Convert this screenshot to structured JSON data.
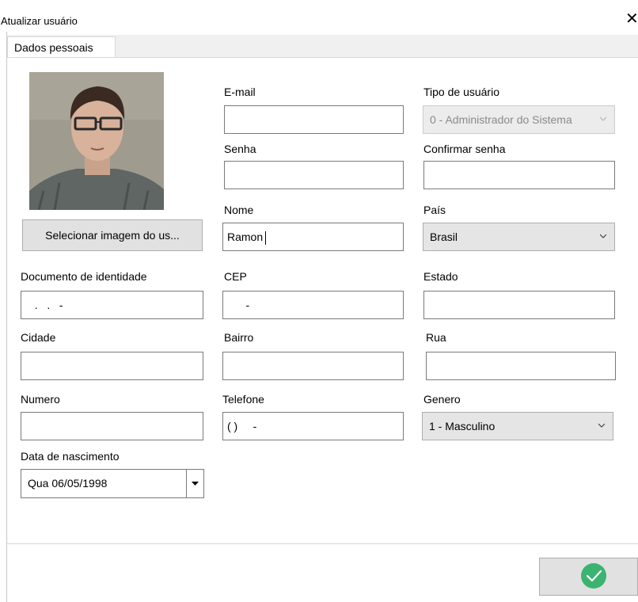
{
  "window": {
    "title": "Atualizar usuário",
    "close_glyph": "✕"
  },
  "tabs": [
    {
      "label": "Dados pessoais",
      "active": true
    }
  ],
  "photo": {
    "icon": "user-photo"
  },
  "select_image_button": {
    "label": "Selecionar imagem do us..."
  },
  "fields": {
    "email": {
      "label": "E-mail",
      "value": ""
    },
    "tipo_usuario": {
      "label": "Tipo de usuário",
      "value": "0 - Administrador do Sistema",
      "disabled": true
    },
    "senha": {
      "label": "Senha",
      "value": ""
    },
    "confirmar_senha": {
      "label": "Confirmar senha",
      "value": ""
    },
    "nome": {
      "label": "Nome",
      "value": "Ramon"
    },
    "pais": {
      "label": "País",
      "value": "Brasil"
    },
    "documento": {
      "label": "Documento de identidade",
      "value": "  .   .   -"
    },
    "cep": {
      "label": "CEP",
      "value": "     -"
    },
    "estado": {
      "label": "Estado",
      "value": ""
    },
    "cidade": {
      "label": "Cidade",
      "value": ""
    },
    "bairro": {
      "label": "Bairro",
      "value": ""
    },
    "rua": {
      "label": "Rua",
      "value": ""
    },
    "numero": {
      "label": "Numero",
      "value": ""
    },
    "telefone": {
      "label": "Telefone",
      "value": "( )     -"
    },
    "genero": {
      "label": "Genero",
      "value": "1 - Masculino"
    },
    "data_nascimento": {
      "label": "Data de nascimento",
      "value": "Qua 06/05/1998"
    }
  },
  "confirm_button": {
    "icon": "check-circle-icon",
    "color": "#3cb371"
  }
}
